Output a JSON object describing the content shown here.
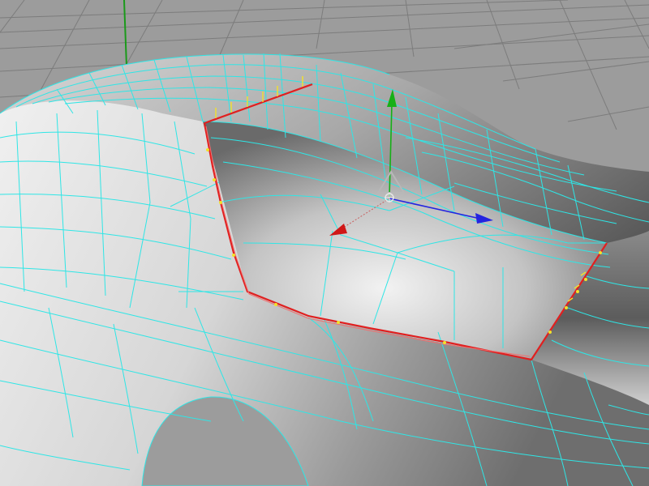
{
  "viewport": {
    "name": "perspective-viewport",
    "background_color": "#9c9c9c",
    "grid_color": "#7c7c7c",
    "view_axis_color": "#1a9a1a"
  },
  "model": {
    "name": "car-body-mesh",
    "wireframe_color": "#2ee6e6",
    "shading": "smooth-gray"
  },
  "selection": {
    "component": "edge-loop",
    "edge_color": "#e02020",
    "vertex_color": "#f2e22a",
    "normal_color": "#f2e22a"
  },
  "manipulator": {
    "tool": "move-tool",
    "x_axis_color": "#2424e0",
    "y_axis_color": "#16b016",
    "z_axis_color": "#d01818"
  }
}
